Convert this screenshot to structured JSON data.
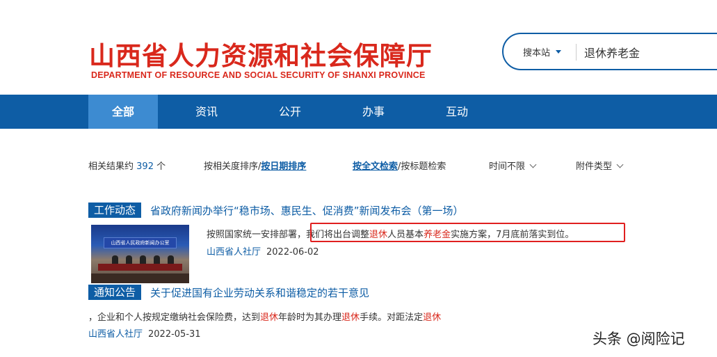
{
  "header": {
    "title_cn": "山西省人力资源和社会保障厅",
    "title_en": "DEPARTMENT OF RESOURCE AND SOCIAL SECURITY OF SHANXI PROVINCE"
  },
  "search": {
    "scope_label": "搜本站",
    "query": "退休养老金"
  },
  "nav": {
    "items": [
      "全部",
      "资讯",
      "公开",
      "办事",
      "互动"
    ]
  },
  "filters": {
    "result_prefix": "相关结果约",
    "result_count": "392",
    "result_suffix": "个",
    "sort_relevance": "按相关度排序",
    "sort_sep": "/",
    "sort_date": "按日期排序",
    "search_full": "按全文检索",
    "search_sep": "/",
    "search_title": "按标题检索",
    "time_filter": "时间不限",
    "attachment_filter": "附件类型"
  },
  "results": [
    {
      "tag": "工作动态",
      "title": "省政府新闻办举行“稳市场、惠民生、促消费”新闻发布会（第一场）",
      "thumb_text": "山西省人民政府新闻办公室",
      "snippet": {
        "p1": "按照国家统一安排部署，",
        "p2": "我们将出台调整",
        "h1": "退休",
        "p3": "人员基本",
        "h2": "养老金",
        "p4": "实施方案，7月底前落实到位。"
      },
      "source": "山西省人社厅",
      "date": "2022-06-02"
    },
    {
      "tag": "通知公告",
      "title": "关于促进国有企业劳动关系和谐稳定的若干意见",
      "snippet": {
        "p1": "，企业和个人按规定缴纳社会保险费，达到",
        "h1": "退休",
        "p2": "年龄时为其办理",
        "h2": "退休",
        "p3": "手续。对距法定",
        "h3": "退休"
      },
      "source": "山西省人社厅",
      "date": "2022-05-31"
    }
  ],
  "watermark": "头条 @阅险记",
  "colors": {
    "brand_blue": "#0e5da5",
    "nav_active": "#3d8bd1",
    "highlight_red": "#d9281c",
    "annotation_box": "#e01f1f"
  }
}
